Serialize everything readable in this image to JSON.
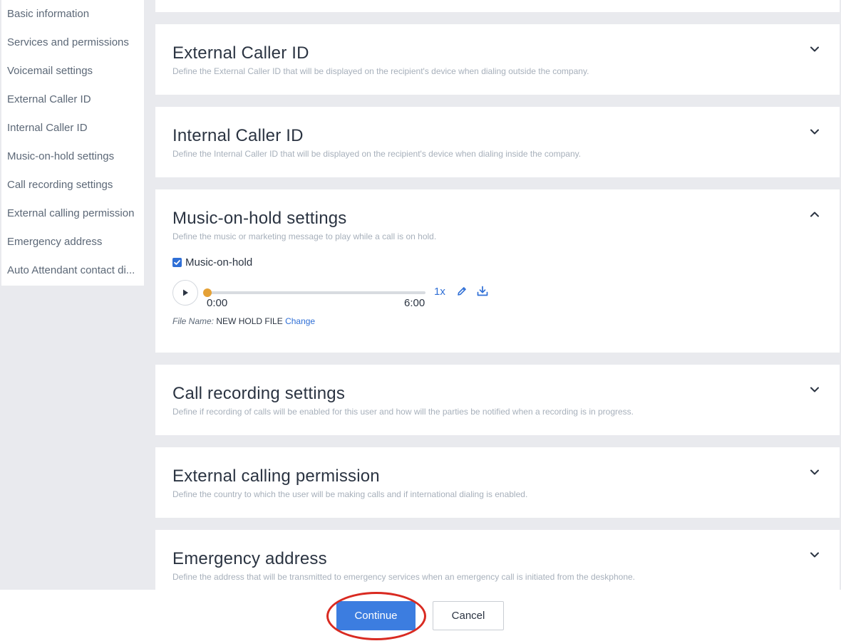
{
  "sidebar": {
    "items": [
      {
        "label": "Basic information"
      },
      {
        "label": "Services and permissions"
      },
      {
        "label": "Voicemail settings"
      },
      {
        "label": "External Caller ID"
      },
      {
        "label": "Internal Caller ID"
      },
      {
        "label": "Music-on-hold settings"
      },
      {
        "label": "Call recording settings"
      },
      {
        "label": "External calling permission"
      },
      {
        "label": "Emergency address"
      },
      {
        "label": "Auto Attendant contact di..."
      }
    ]
  },
  "sections": [
    {
      "title": "External Caller ID",
      "description": "Define the External Caller ID that will be displayed on the recipient's device when dialing outside the company.",
      "chevron_icon": "chevron-down-icon"
    },
    {
      "title": "Internal Caller ID",
      "description": "Define the Internal Caller ID that will be displayed on the recipient's device when dialing inside the company.",
      "chevron_icon": "chevron-down-icon"
    },
    {
      "title": "Music-on-hold settings",
      "description": "Define the music or marketing message to play while a call is on hold.",
      "chevron_icon": "chevron-up-icon"
    },
    {
      "title": "Call recording settings",
      "description": "Define if recording of calls will be enabled for this user and how will the parties be notified when a recording is in progress.",
      "chevron_icon": "chevron-down-icon"
    },
    {
      "title": "External calling permission",
      "description": "Define the country to which the user will be making calls and if international dialing is enabled.",
      "chevron_icon": "chevron-down-icon"
    },
    {
      "title": "Emergency address",
      "description": "Define the address that will be transmitted to emergency services when an emergency call is initiated from the deskphone.",
      "chevron_icon": "chevron-down-icon"
    }
  ],
  "music_on_hold": {
    "checkbox_label": "Music-on-hold",
    "checked": true,
    "player": {
      "current_time": "0:00",
      "total_time": "6:00",
      "progress": 0,
      "speed": "1x"
    },
    "file_name_label": "File Name:",
    "file_name_value": "NEW HOLD FILE",
    "change_label": "Change"
  },
  "footer": {
    "continue_label": "Continue",
    "cancel_label": "Cancel"
  },
  "colors": {
    "accent": "#3c7de0",
    "link": "#2f6fd6",
    "progress_knob": "#e5a136",
    "highlight_ring": "#d92a21",
    "background": "#e9eaee"
  }
}
